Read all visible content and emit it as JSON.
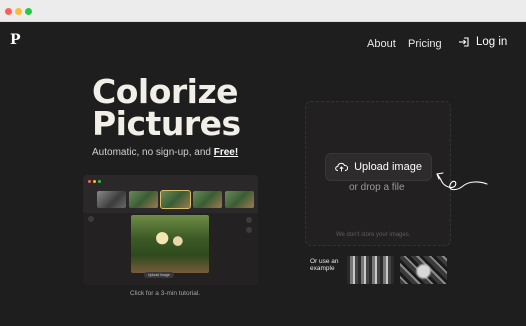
{
  "window": {
    "controls": [
      "close",
      "minimize",
      "maximize"
    ]
  },
  "header": {
    "logo": "P",
    "nav": {
      "about": "About",
      "pricing": "Pricing",
      "login": "Log in"
    }
  },
  "hero": {
    "title_line1": "Colorize",
    "title_line2": "Pictures",
    "subtitle_prefix": "Automatic, no sign-up, and ",
    "subtitle_emphasis": "Free!"
  },
  "preview": {
    "chip_label": "Upload Image",
    "tutorial_text": "Click for a 3-min tutorial."
  },
  "upload": {
    "button_label": "Upload image",
    "drop_text": "or drop a file",
    "privacy_note": "We don't store your images."
  },
  "examples": {
    "label_line1": "Or use an",
    "label_line2": "example"
  },
  "colors": {
    "page_bg": "#1f1e1e",
    "button_bg": "#2d2b2b",
    "text": "#ffffff"
  },
  "icons": {
    "login": "login-arrow-icon",
    "upload": "cloud-upload-icon",
    "arrow": "hand-drawn-arrow-icon"
  }
}
